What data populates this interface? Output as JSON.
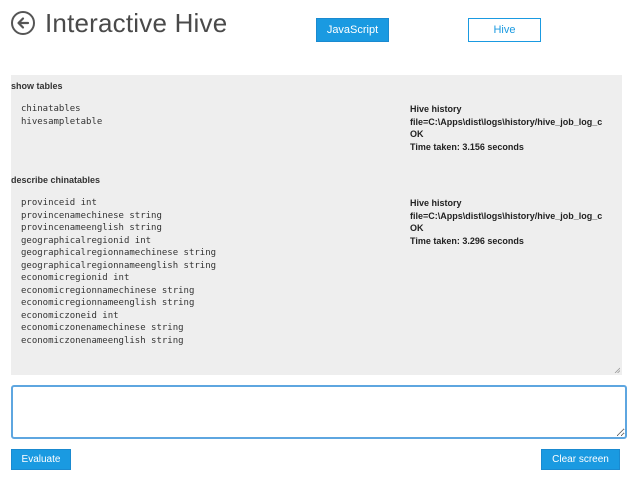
{
  "header": {
    "title": "Interactive Hive",
    "modes": [
      {
        "label": "JavaScript",
        "selected": true
      },
      {
        "label": "Hive",
        "selected": false
      }
    ]
  },
  "output": {
    "blocks": [
      {
        "command": "show tables",
        "lines": [
          "chinatables",
          "hivesampletable"
        ],
        "status": [
          "Hive history",
          "file=C:\\Apps\\dist\\logs\\history/hive_job_log_c",
          "OK",
          "Time taken: 3.156 seconds"
        ]
      },
      {
        "command": "describe chinatables",
        "lines": [
          "provinceid int",
          "provincenamechinese string",
          "provincenameenglish string",
          "geographicalregionid int",
          "geographicalregionnamechinese string",
          "geographicalregionnameenglish string",
          "economicregionid int",
          "economicregionnamechinese string",
          "economicregionnameenglish string",
          "economiczoneid int",
          "economiczonenamechinese string",
          "economiczonenameenglish string"
        ],
        "status": [
          "Hive history",
          "file=C:\\Apps\\dist\\logs\\history/hive_job_log_c",
          "OK",
          "Time taken: 3.296 seconds"
        ]
      }
    ]
  },
  "input": {
    "value": ""
  },
  "actions": {
    "evaluate_label": "Evaluate",
    "clear_label": "Clear screen"
  },
  "colors": {
    "accent": "#1a9ae1",
    "output_background": "#eeeeee",
    "input_border": "#5ea6e0"
  }
}
